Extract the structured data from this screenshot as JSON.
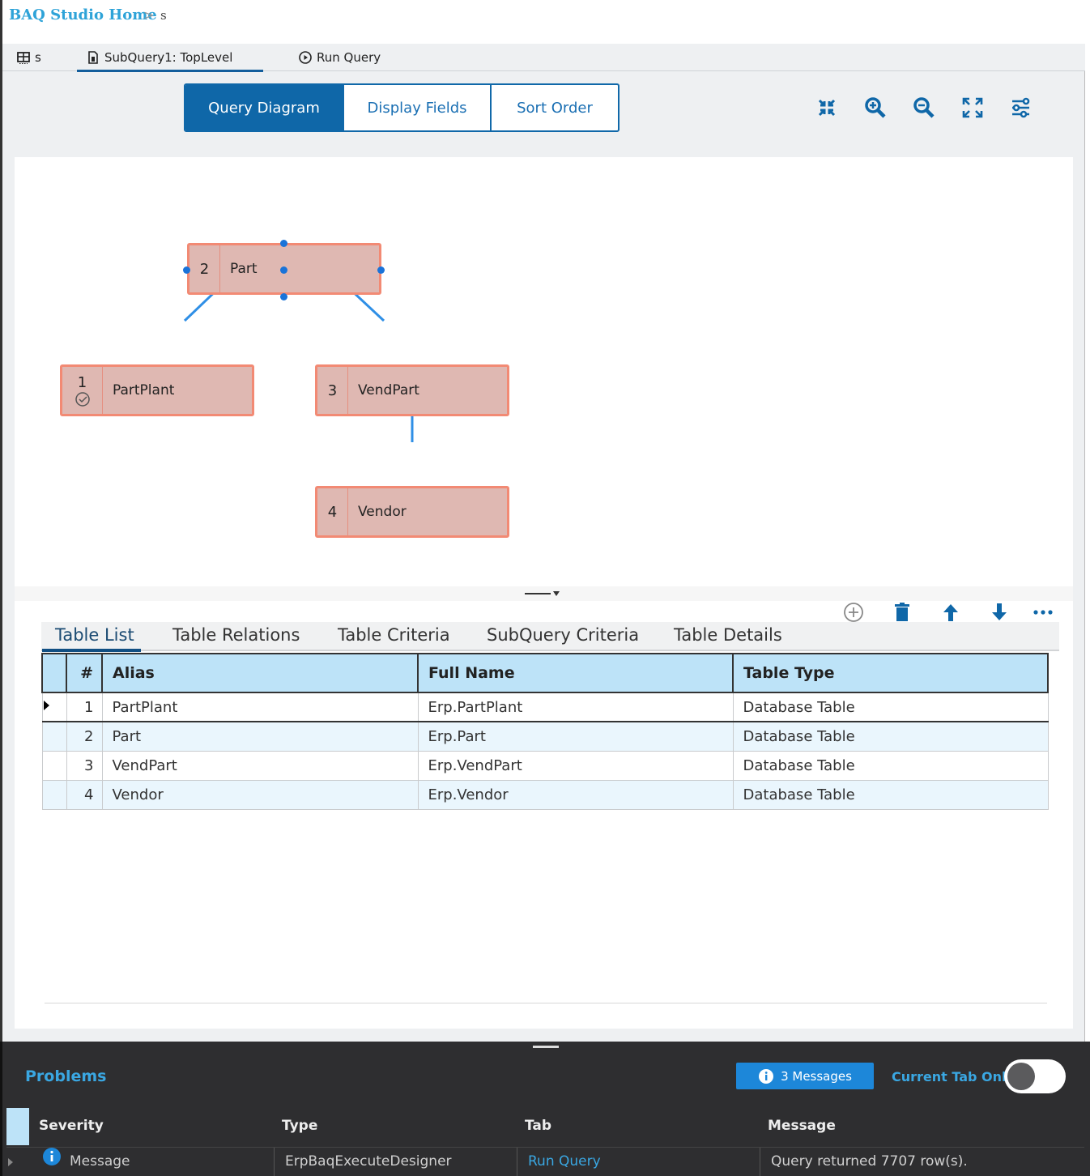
{
  "breadcrumb": {
    "home": "BAQ Studio Home",
    "separator": ">",
    "current": "s"
  },
  "toolbar": {
    "query_tab": "s",
    "subquery_tab": "SubQuery1: TopLevel",
    "run_query": "Run Query"
  },
  "view_tabs": [
    {
      "label": "Query Diagram",
      "active": true
    },
    {
      "label": "Display Fields",
      "active": false
    },
    {
      "label": "Sort Order",
      "active": false
    }
  ],
  "diagram_tools": [
    "collapse-icon",
    "zoom-in-icon",
    "zoom-out-icon",
    "fit-screen-icon",
    "layout-settings-icon"
  ],
  "diagram": {
    "nodes": [
      {
        "num": "2",
        "name": "Part"
      },
      {
        "num": "1",
        "name": "PartPlant"
      },
      {
        "num": "3",
        "name": "VendPart"
      },
      {
        "num": "4",
        "name": "Vendor"
      }
    ]
  },
  "table_actions": [
    "add-icon",
    "delete-icon",
    "move-up-icon",
    "move-down-icon",
    "more-icon"
  ],
  "lower_tabs": [
    {
      "label": "Table List",
      "active": true
    },
    {
      "label": "Table Relations",
      "active": false
    },
    {
      "label": "Table Criteria",
      "active": false
    },
    {
      "label": "SubQuery Criteria",
      "active": false
    },
    {
      "label": "Table Details",
      "active": false
    }
  ],
  "table": {
    "headers": [
      "#",
      "Alias",
      "Full Name",
      "Table Type"
    ],
    "rows": [
      [
        "1",
        "PartPlant",
        "Erp.PartPlant",
        "Database Table"
      ],
      [
        "2",
        "Part",
        "Erp.Part",
        "Database Table"
      ],
      [
        "3",
        "VendPart",
        "Erp.VendPart",
        "Database Table"
      ],
      [
        "4",
        "Vendor",
        "Erp.Vendor",
        "Database Table"
      ]
    ]
  },
  "problems": {
    "title": "Problems",
    "messages_badge": "3 Messages",
    "current_tab_only": "Current Tab Only",
    "headers": [
      "Severity",
      "Type",
      "Tab",
      "Message"
    ],
    "rows": [
      {
        "severity": "Message",
        "type": "ErpBaqExecuteDesigner",
        "tab": "Run Query",
        "message": "Query returned 7707 row(s)."
      }
    ]
  },
  "colors": {
    "accent": "#0f67a8",
    "node_fill": "#dfb8b2",
    "node_border": "#f28a74",
    "header_fill": "#bde3f8",
    "problems_bg": "#2e2e30",
    "link": "#3aa7e2"
  }
}
